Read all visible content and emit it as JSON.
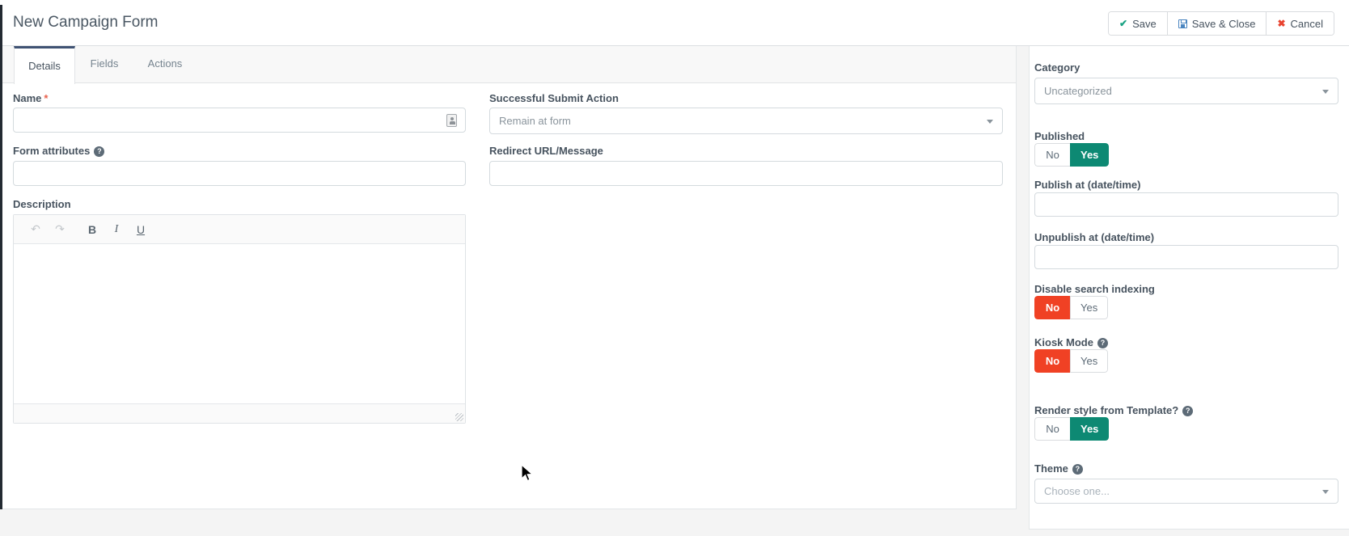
{
  "header": {
    "title": "New Campaign Form",
    "buttons": {
      "save": "Save",
      "save_close": "Save & Close",
      "cancel": "Cancel"
    }
  },
  "tabs": [
    {
      "label": "Details",
      "active": true
    },
    {
      "label": "Fields",
      "active": false
    },
    {
      "label": "Actions",
      "active": false
    }
  ],
  "main": {
    "name": {
      "label": "Name",
      "required_mark": "*",
      "value": ""
    },
    "form_attributes": {
      "label": "Form attributes",
      "value": ""
    },
    "description": {
      "label": "Description",
      "value": ""
    },
    "submit_action": {
      "label": "Successful Submit Action",
      "value": "Remain at form"
    },
    "redirect": {
      "label": "Redirect URL/Message",
      "value": ""
    }
  },
  "sidebar": {
    "category": {
      "label": "Category",
      "value": "Uncategorized"
    },
    "published": {
      "label": "Published",
      "no_label": "No",
      "yes_label": "Yes",
      "active": "yes"
    },
    "publish_at": {
      "label": "Publish at (date/time)",
      "value": ""
    },
    "unpublish_at": {
      "label": "Unpublish at (date/time)",
      "value": ""
    },
    "disable_search_indexing": {
      "label": "Disable search indexing",
      "no_label": "No",
      "yes_label": "Yes",
      "active": "no"
    },
    "kiosk_mode": {
      "label": "Kiosk Mode",
      "no_label": "No",
      "yes_label": "Yes",
      "active": "no"
    },
    "render_style": {
      "label": "Render style from Template?",
      "no_label": "No",
      "yes_label": "Yes",
      "active": "yes"
    },
    "theme": {
      "label": "Theme",
      "placeholder": "Choose one..."
    }
  },
  "icons": {
    "help": "?",
    "save_check": "✔",
    "cancel_x": "✖",
    "undo": "↶",
    "redo": "↷",
    "bold": "B",
    "italic": "I",
    "underline": "U"
  },
  "colors": {
    "toggle_active_green": "#0d8973",
    "toggle_active_red": "#f04124",
    "tab_active_border": "#3f5273",
    "label_text": "#47535f",
    "required_red": "#e8604c",
    "save_check_green": "#19a283",
    "cancel_x_red": "#e8432f",
    "floppy_blue": "#4a85c0"
  }
}
